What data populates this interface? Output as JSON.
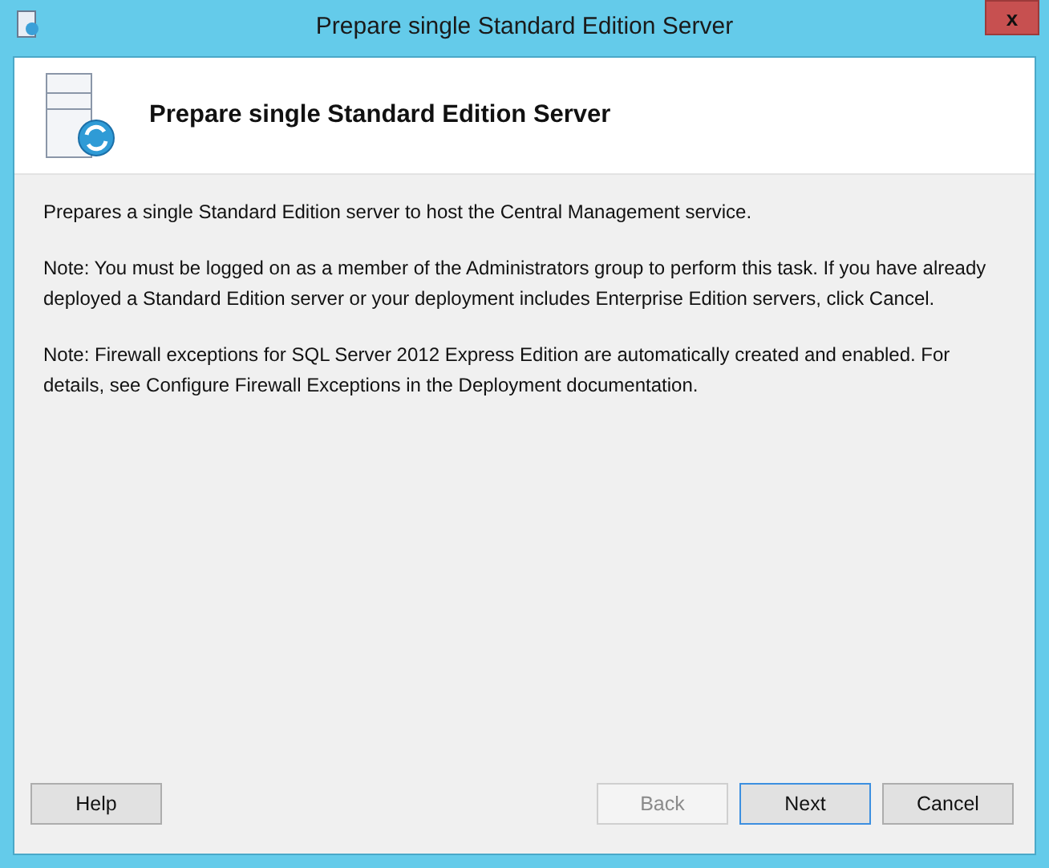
{
  "window": {
    "title": "Prepare single Standard Edition Server",
    "close": "x"
  },
  "header": {
    "title": "Prepare single Standard Edition Server"
  },
  "paragraphs": [
    "Prepares a single Standard Edition server to host the Central Management service.",
    "Note: You must be logged on as a member of the Administrators group to perform this task. If you have already deployed a Standard Edition server or your deployment includes Enterprise Edition servers, click Cancel.",
    "Note: Firewall exceptions for SQL Server 2012 Express Edition are automatically created and enabled. For details, see Configure Firewall Exceptions in the Deployment documentation."
  ],
  "left_buttons": [
    {
      "label": "Help",
      "disabled": false,
      "default": false
    }
  ],
  "right_buttons": [
    {
      "label": "Back",
      "disabled": true,
      "default": false
    },
    {
      "label": "Next",
      "disabled": false,
      "default": true
    },
    {
      "label": "Cancel",
      "disabled": false,
      "default": false
    }
  ]
}
